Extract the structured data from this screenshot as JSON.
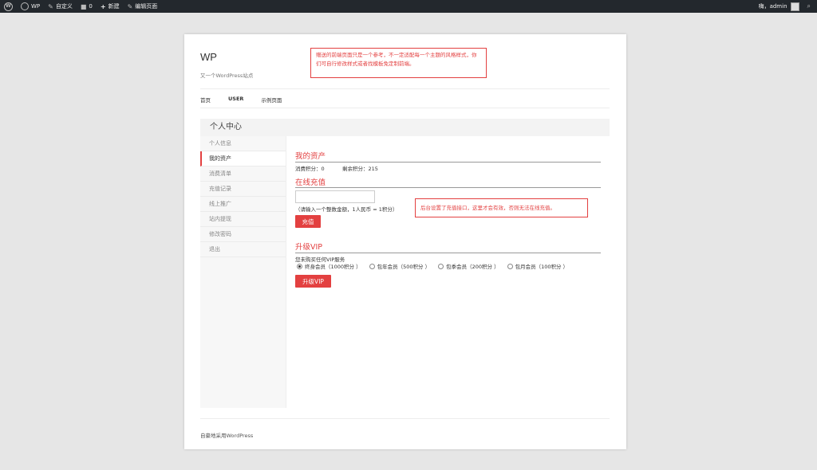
{
  "adminbar": {
    "site_name": "WP",
    "customize": "自定义",
    "comments_count": "0",
    "new": "新建",
    "edit_page": "编辑页面",
    "greeting": "嗨，",
    "user": "admin"
  },
  "site": {
    "title": "WP",
    "description": "又一个WordPress站点"
  },
  "notes": {
    "top": "赠送的前端页面只是一个参考，不一定适配每一个主题的风格样式，你们可自行修改样式或者找模板免定制前端。",
    "recharge": "后台设置了充值接口，这里才会有效，否则无法在线充值。"
  },
  "nav": {
    "items": [
      "首页",
      "USER",
      "示例页面"
    ]
  },
  "user_center": {
    "title": "个人中心"
  },
  "sidebar": {
    "items": [
      "个人信息",
      "我的资产",
      "消费清单",
      "充值记录",
      "线上推广",
      "站内提现",
      "修改密码",
      "退出"
    ]
  },
  "assets": {
    "title": "我的资产",
    "spent_label": "消费积分：",
    "spent_value": "0",
    "remaining_label": "剩余积分：",
    "remaining_value": "215"
  },
  "recharge": {
    "title": "在线充值",
    "input_value": "",
    "hint": "（请输入一个整数金额，1人民币 = 1积分）",
    "button": "充值"
  },
  "vip": {
    "title": "升级VIP",
    "status": "您未购买任何VIP服务",
    "options": [
      "终身会员（1000积分 ）",
      "包年会员（500积分 ）",
      "包季会员（200积分 ）",
      "包月会员（100积分 ）"
    ],
    "selected_index": 0,
    "button": "升级VIP"
  },
  "footer": {
    "text": "自豪地采用WordPress"
  },
  "colors": {
    "accent": "#e34040",
    "adminbar": "#23282d",
    "background": "#e6e6e6"
  }
}
